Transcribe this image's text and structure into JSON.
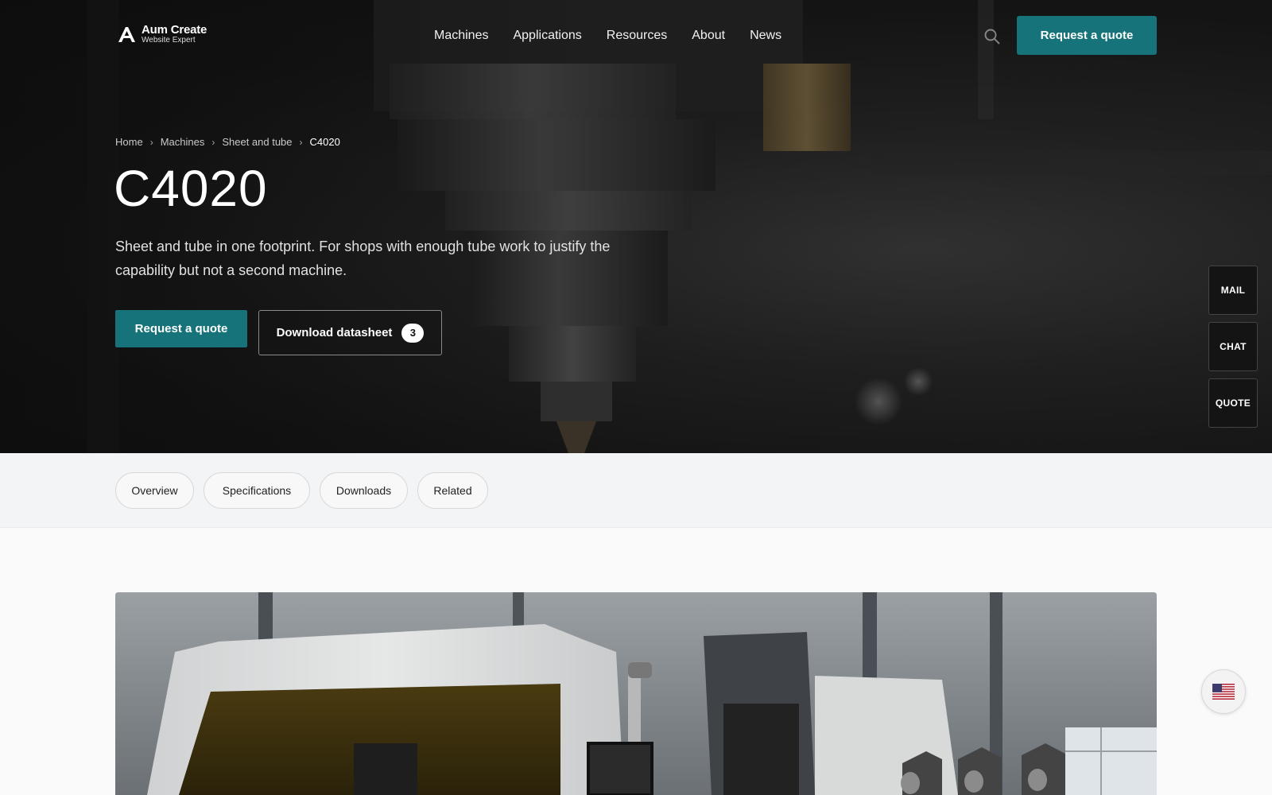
{
  "brand": {
    "name": "Aum Create",
    "tagline": "Website Expert"
  },
  "nav": {
    "items": [
      {
        "label": "Machines"
      },
      {
        "label": "Applications"
      },
      {
        "label": "Resources"
      },
      {
        "label": "About"
      },
      {
        "label": "News"
      }
    ],
    "cta_label": "Request a quote",
    "search_icon": "search-icon"
  },
  "breadcrumb": {
    "items": [
      "Home",
      "Machines",
      "Sheet and tube"
    ],
    "current": "C4020",
    "separator": "›"
  },
  "hero": {
    "title": "C4020",
    "lead": "Sheet and tube in one footprint. For shops with enough tube work to justify the capability but not a second machine.",
    "primary_cta": "Request a quote",
    "secondary_cta": "Download datasheet",
    "download_count": "3"
  },
  "side_tabs": {
    "mail": "MAIL",
    "chat": "CHAT",
    "quote": "QUOTE"
  },
  "tabs": [
    {
      "label": "Overview"
    },
    {
      "label": "Specifications"
    },
    {
      "label": "Downloads"
    },
    {
      "label": "Related"
    }
  ],
  "locale": {
    "flag_icon": "us-flag-icon"
  },
  "colors": {
    "accent": "#17737a",
    "hero_bg": "#161616",
    "tabs_bg": "#f3f4f6",
    "page_bg": "#fafafa"
  }
}
